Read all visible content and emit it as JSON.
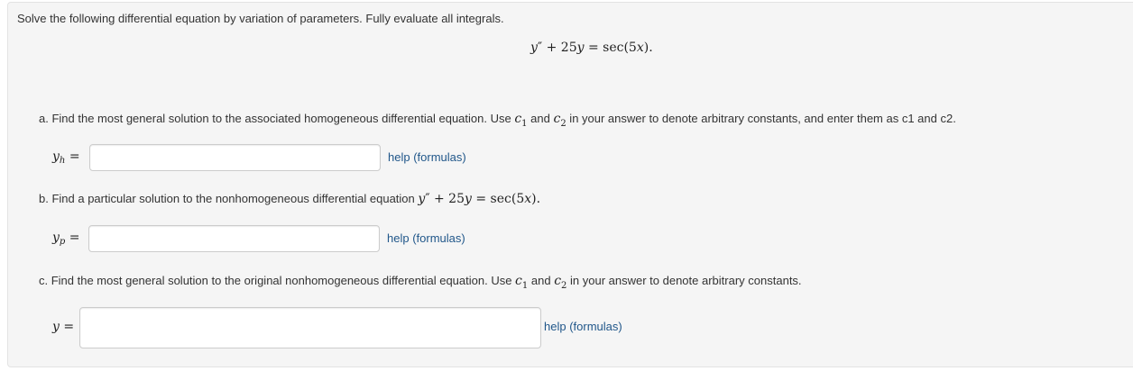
{
  "problem": {
    "intro": "Solve the following differential equation by variation of parameters. Fully evaluate all integrals.",
    "equation": {
      "y": "y",
      "prime": "″",
      "plus": " + 25",
      "y2": "y",
      "equals": " = sec(5",
      "x": "x",
      "close": ")."
    }
  },
  "part_a": {
    "text_1": "a. Find the most general solution to the associated homogeneous differential equation. Use ",
    "c1": "c",
    "c1_sub": "1",
    "and": " and ",
    "c2": "c",
    "c2_sub": "2",
    "text_2": " in your answer to denote arbitrary constants, and enter them as c1 and c2.",
    "label_var": "y",
    "label_sub": "h",
    "label_eq": " =",
    "value": "",
    "help_label": "help (formulas)"
  },
  "part_b": {
    "text_1": "b. Find a particular solution to the nonhomogeneous differential equation ",
    "eq_y": "y",
    "eq_prime": "″",
    "eq_plus": " + 25",
    "eq_y2": "y",
    "eq_equals": " = sec(5",
    "eq_x": "x",
    "eq_close": ").",
    "label_var": "y",
    "label_sub": "p",
    "label_eq": " =",
    "value": "",
    "help_label": "help (formulas)"
  },
  "part_c": {
    "text_1": "c. Find the most general solution to the original nonhomogeneous differential equation. Use ",
    "c1": "c",
    "c1_sub": "1",
    "and": " and ",
    "c2": "c",
    "c2_sub": "2",
    "text_2": " in your answer to denote arbitrary constants.",
    "label_var": "y",
    "label_eq": " =",
    "value": "",
    "help_label": "help (formulas)"
  },
  "colors": {
    "panel_bg": "#f5f5f5",
    "link": "#21578a",
    "input_border": "#cccccc"
  }
}
